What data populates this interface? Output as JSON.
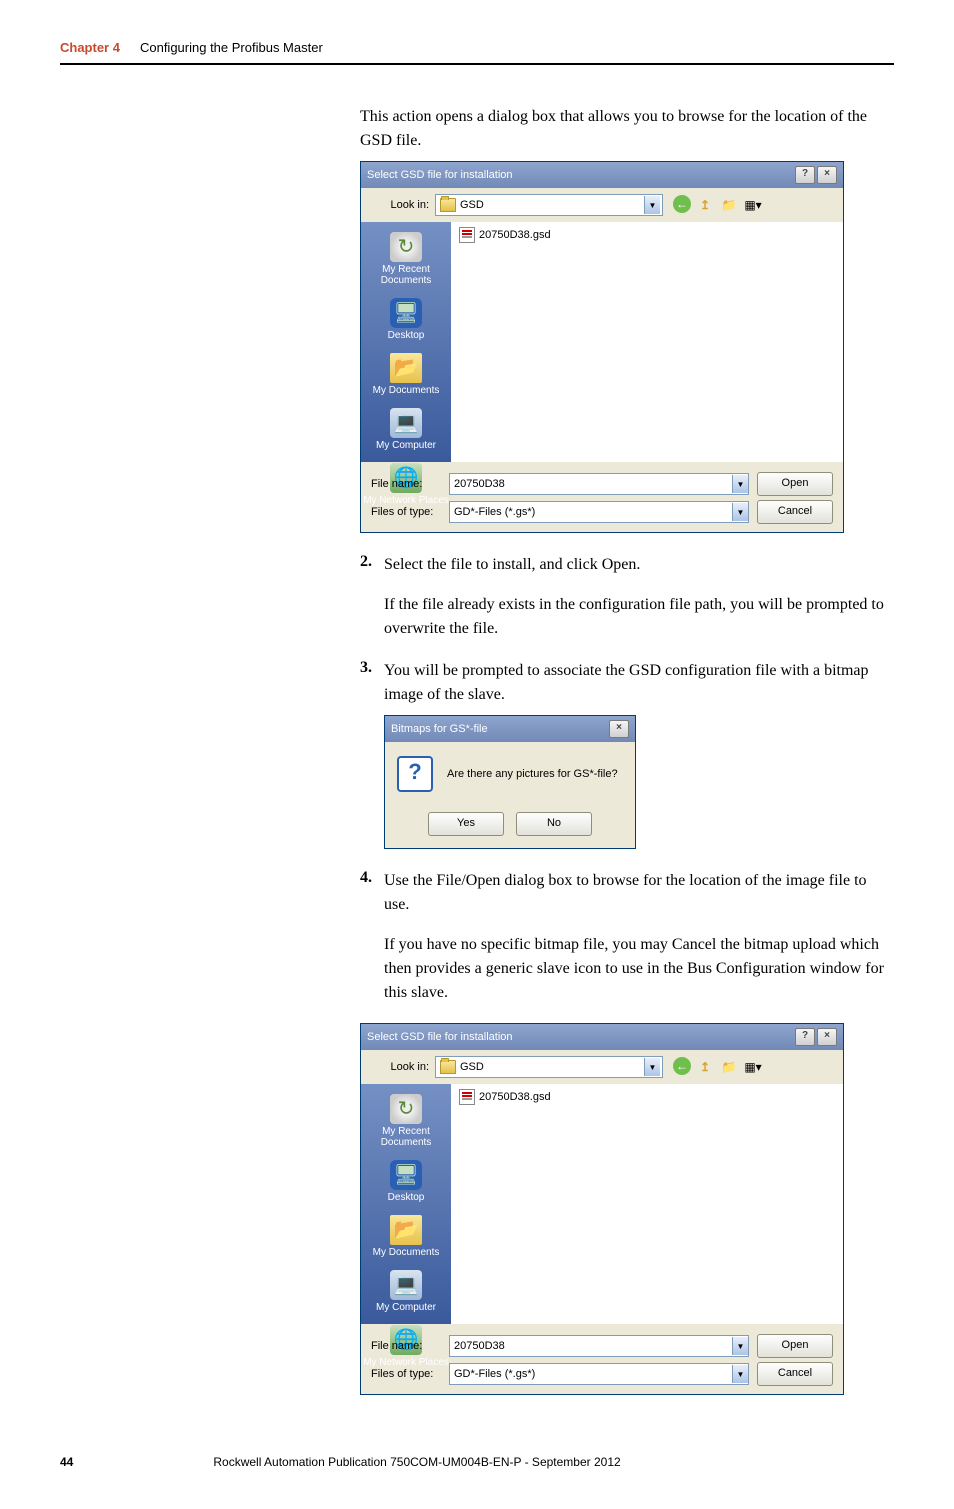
{
  "header": {
    "chapter_num": "Chapter 4",
    "chapter_title": "Configuring the Profibus Master"
  },
  "intro": "This action opens a dialog box that allows you to browse for the location of the GSD file.",
  "dialog1": {
    "title": "Select GSD file for installation",
    "look_in_label": "Look in:",
    "look_in_value": "GSD",
    "file_listed": "20750D38.gsd",
    "places": {
      "recent": "My Recent Documents",
      "desktop": "Desktop",
      "mydocs": "My Documents",
      "mycomp": "My Computer",
      "mynet": "My Network Places"
    },
    "file_name_label": "File name:",
    "file_name_value": "20750D38",
    "file_type_label": "Files of type:",
    "file_type_value": "GD*-Files (*.gs*)",
    "open_btn": "Open",
    "cancel_btn": "Cancel"
  },
  "step2": {
    "num": "2.",
    "text": "Select the file to install, and click Open.",
    "cont": "If the file already exists in the configuration file path, you will be prompted to overwrite the file."
  },
  "step3": {
    "num": "3.",
    "text": "You will be prompted to associate the GSD configuration file with a bitmap image of the slave."
  },
  "prompt": {
    "title": "Bitmaps for GS*-file",
    "question": "Are there any pictures for GS*-file?",
    "yes": "Yes",
    "no": "No"
  },
  "step4": {
    "num": "4.",
    "text": "Use the File/Open dialog box to browse for the location of the image file to use.",
    "cont": "If you have no specific bitmap file, you may Cancel the bitmap upload which then provides a generic slave icon to use in the Bus Configuration window for this slave."
  },
  "footer": {
    "page": "44",
    "pub": "Rockwell Automation Publication 750COM-UM004B-EN-P - September 2012"
  }
}
